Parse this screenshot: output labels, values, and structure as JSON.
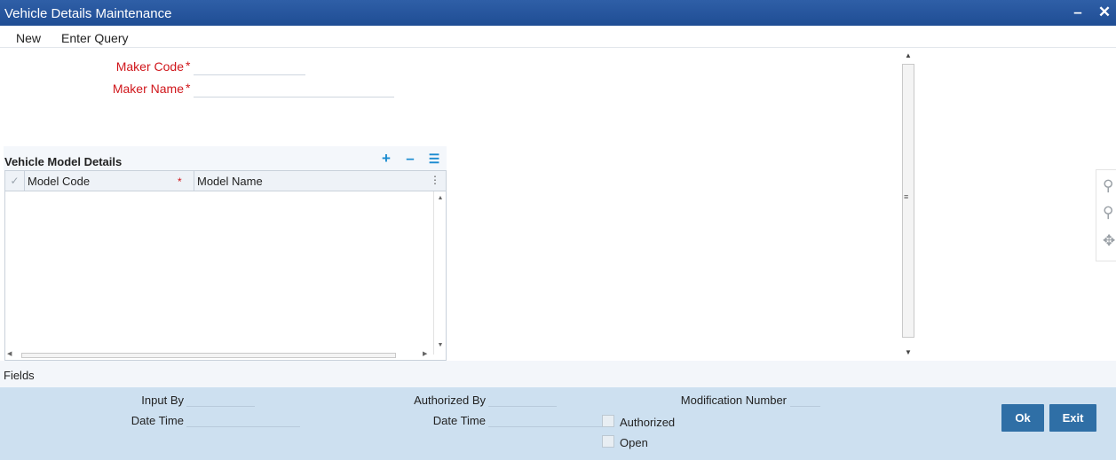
{
  "window": {
    "title": "Vehicle Details Maintenance",
    "minimize_icon": "minimize-icon",
    "close_icon": "close-icon"
  },
  "menu": {
    "items": [
      {
        "label": "New"
      },
      {
        "label": "Enter Query"
      }
    ]
  },
  "form": {
    "maker_code": {
      "label": "Maker Code",
      "required": "*",
      "value": ""
    },
    "maker_name": {
      "label": "Maker Name",
      "required": "*",
      "value": ""
    }
  },
  "grid": {
    "title": "Vehicle Model Details",
    "tools": {
      "add_icon": "plus-icon",
      "remove_icon": "minus-icon",
      "view_icon": "list-icon"
    },
    "columns": [
      {
        "label": "Model Code",
        "required": "*"
      },
      {
        "label": "Model Name",
        "required": ""
      }
    ],
    "rows": [],
    "colors": {
      "tool_accent": "#1a8bd0"
    }
  },
  "side_tools": [
    "zoom-in-icon",
    "zoom-out-icon",
    "expand-icon"
  ],
  "fields_section": {
    "label": "Fields"
  },
  "audit": {
    "input_by": {
      "label": "Input By",
      "value": ""
    },
    "input_date_time": {
      "label": "Date Time",
      "value": ""
    },
    "authorized_by": {
      "label": "Authorized By",
      "value": ""
    },
    "auth_date_time": {
      "label": "Date Time",
      "value": ""
    },
    "modification_number": {
      "label": "Modification Number",
      "value": ""
    },
    "authorized": {
      "label": "Authorized",
      "checked": false
    },
    "open": {
      "label": "Open",
      "checked": false
    }
  },
  "buttons": {
    "ok": "Ok",
    "exit": "Exit"
  },
  "colors": {
    "titlebar": "#1f4d94",
    "required_label": "#d0161b",
    "audit_background": "#cde0f0",
    "button": "#2f6fa6"
  }
}
